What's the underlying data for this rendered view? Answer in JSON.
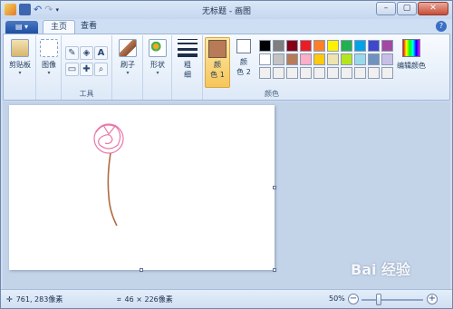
{
  "window": {
    "title": "无标题 - 画图",
    "minimize": "–",
    "maximize": "▢",
    "close": "✕"
  },
  "tabs": {
    "file": "▤ ▾",
    "home": "主页",
    "view": "查看"
  },
  "groups": {
    "clipboard": {
      "label": "剪贴板"
    },
    "image": {
      "label": "图像"
    },
    "tools": {
      "label": "工具",
      "pencil": "✎",
      "fill": "◈",
      "text": "A",
      "eraser": "▭",
      "picker": "✚",
      "magnifier": "⌕"
    },
    "brushes": {
      "label": "刷子"
    },
    "shapes": {
      "label": "形状"
    },
    "size": {
      "label_top": "粗",
      "label_bottom": "细"
    },
    "colors": {
      "label": "颜色",
      "color1": {
        "label_top": "颜",
        "label_bottom": "色 1",
        "value": "#b97a57"
      },
      "color2": {
        "label_top": "颜",
        "label_bottom": "色 2",
        "value": "#ffffff"
      },
      "edit": "编辑颜色",
      "palette": [
        "#000000",
        "#7f7f7f",
        "#880015",
        "#ed1c24",
        "#ff7f27",
        "#fff200",
        "#22b14c",
        "#00a2e8",
        "#3f48cc",
        "#a349a4",
        "#ffffff",
        "#c3c3c3",
        "#b97a57",
        "#ffaec9",
        "#ffc90e",
        "#efe4b0",
        "#b5e61d",
        "#99d9ea",
        "#7092be",
        "#c8bfe7",
        "#f0f0f0",
        "#f0f0f0",
        "#f0f0f0",
        "#f0f0f0",
        "#f0f0f0",
        "#f0f0f0",
        "#f0f0f0",
        "#f0f0f0",
        "#f0f0f0",
        "#f0f0f0"
      ]
    }
  },
  "drawing": {
    "rose_color": "#e878a8",
    "stem_color": "#b06a40"
  },
  "status": {
    "cursor_pos": "761, 283像素",
    "selection_size": "46 × 226像素",
    "zoom": "50%",
    "zoom_minus": "−",
    "zoom_plus": "+"
  },
  "watermark": "Bai 经验"
}
